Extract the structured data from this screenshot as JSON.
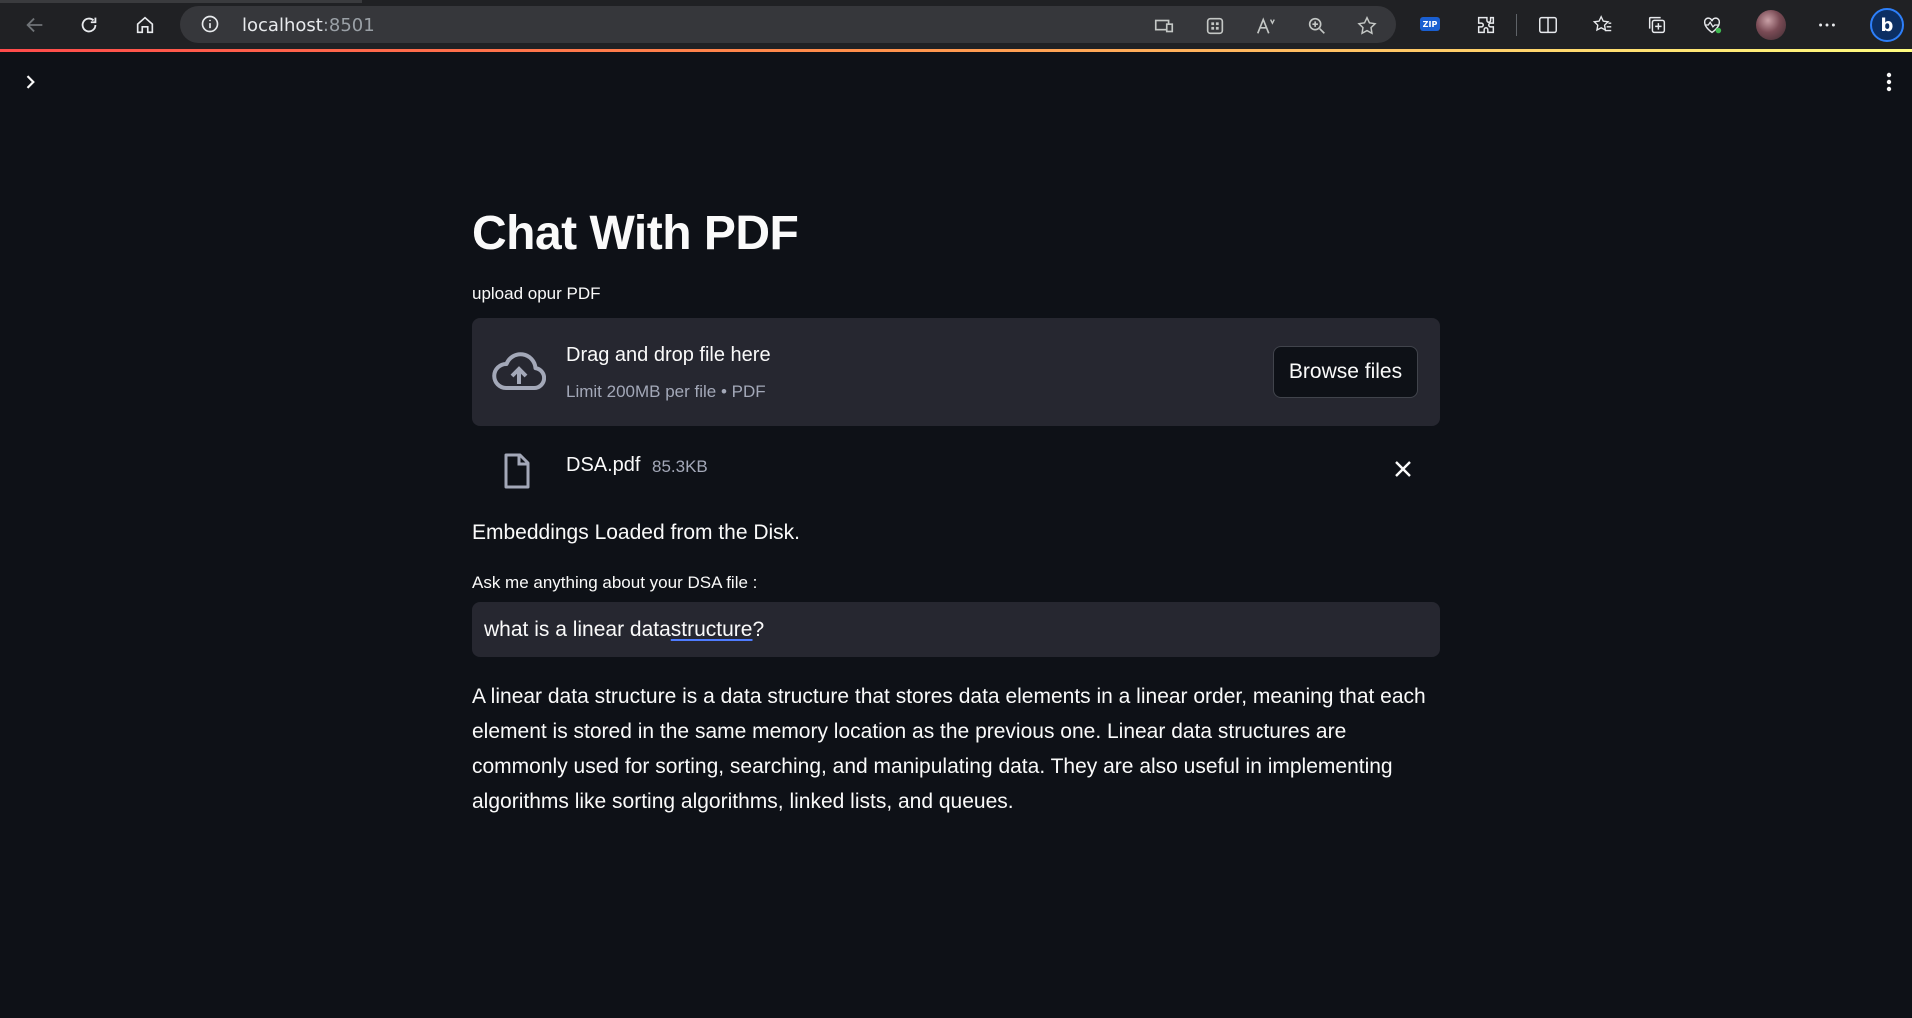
{
  "browser": {
    "url_host": "localhost",
    "url_port": ":8501"
  },
  "page": {
    "title": "Chat With PDF",
    "upload_label": "upload opur PDF",
    "dropzone": {
      "title": "Drag and drop file here",
      "subtitle": "Limit 200MB per file • PDF",
      "browse_label": "Browse files"
    },
    "file": {
      "name": "DSA.pdf",
      "size": "85.3KB"
    },
    "status_text": "Embeddings Loaded from the Disk.",
    "question_label": "Ask me anything about your DSA file :",
    "question": {
      "prefix": "what is a linear data ",
      "underlined": "structure",
      "suffix": "?"
    },
    "answer": "A linear data structure is a data structure that stores data elements in a linear order, meaning that each element is stored in the same memory location as the previous one. Linear data structures are commonly used for sorting, searching, and manipulating data. They are also useful in implementing algorithms like sorting algorithms, linked lists, and queues."
  },
  "colors": {
    "background": "#0e1117",
    "widget": "#262730",
    "accent_gradient_start": "#ff4b4b",
    "accent_gradient_end": "#fffd80"
  },
  "icons": [
    "back-icon",
    "refresh-icon",
    "home-icon",
    "info-icon",
    "cast-icon",
    "apps-icon",
    "read-aloud-icon",
    "zoom-icon",
    "favorite-star-icon",
    "zip-icon",
    "extensions-icon",
    "split-screen-icon",
    "favorites-icon",
    "collections-icon",
    "health-icon",
    "profile-avatar",
    "more-icon",
    "bing-copilot-icon",
    "chevron-right-icon",
    "kebab-menu-icon",
    "cloud-upload-icon",
    "file-icon",
    "close-icon"
  ]
}
